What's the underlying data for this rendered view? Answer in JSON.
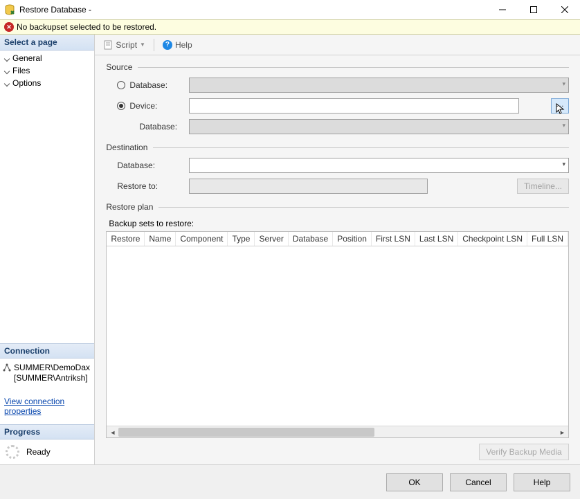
{
  "window": {
    "title": "Restore Database -"
  },
  "warning": {
    "text": "No backupset selected to be restored."
  },
  "sidebar": {
    "select_page": "Select a page",
    "items": [
      "General",
      "Files",
      "Options"
    ],
    "connection_header": "Connection",
    "server": "SUMMER\\DemoDax",
    "user": "[SUMMER\\Antriksh]",
    "view_props": "View connection properties",
    "progress_header": "Progress",
    "progress_status": "Ready"
  },
  "toolbar": {
    "script": "Script",
    "help": "Help"
  },
  "source": {
    "header": "Source",
    "database_label": "Database:",
    "device_label": "Device:",
    "sub_database_label": "Database:",
    "device_value": ""
  },
  "destination": {
    "header": "Destination",
    "database_label": "Database:",
    "database_value": "",
    "restore_to_label": "Restore to:",
    "restore_to_value": "",
    "timeline": "Timeline..."
  },
  "restore_plan": {
    "header": "Restore plan",
    "subheader": "Backup sets to restore:",
    "columns": [
      "Restore",
      "Name",
      "Component",
      "Type",
      "Server",
      "Database",
      "Position",
      "First LSN",
      "Last LSN",
      "Checkpoint LSN",
      "Full LSN"
    ],
    "verify": "Verify Backup Media"
  },
  "footer": {
    "ok": "OK",
    "cancel": "Cancel",
    "help": "Help"
  }
}
